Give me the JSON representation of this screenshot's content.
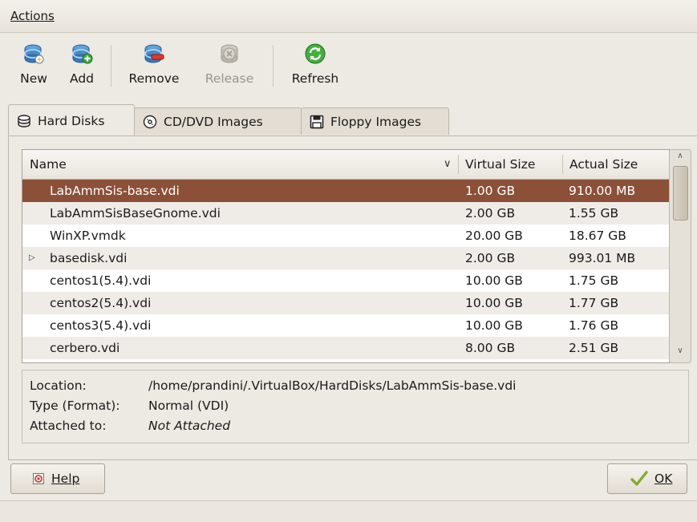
{
  "menubar": {
    "actions_label": "Actions"
  },
  "toolbar": {
    "new_label": "New",
    "add_label": "Add",
    "remove_label": "Remove",
    "release_label": "Release",
    "refresh_label": "Refresh"
  },
  "tabs": [
    {
      "label": "Hard Disks",
      "icon": "hard-disk-icon",
      "active": true
    },
    {
      "label": "CD/DVD Images",
      "icon": "cd-dvd-icon",
      "active": false
    },
    {
      "label": "Floppy Images",
      "icon": "floppy-icon",
      "active": false
    }
  ],
  "table": {
    "columns": [
      "Name",
      "Virtual Size",
      "Actual Size"
    ],
    "rows": [
      {
        "name": "LabAmmSis-base.vdi",
        "virtual_size": "1.00 GB",
        "actual_size": "910.00 MB",
        "selected": true,
        "expandable": false
      },
      {
        "name": "LabAmmSisBaseGnome.vdi",
        "virtual_size": "2.00 GB",
        "actual_size": "1.55 GB",
        "selected": false,
        "expandable": false
      },
      {
        "name": "WinXP.vmdk",
        "virtual_size": "20.00 GB",
        "actual_size": "18.67 GB",
        "selected": false,
        "expandable": false
      },
      {
        "name": "basedisk.vdi",
        "virtual_size": "2.00 GB",
        "actual_size": "993.01 MB",
        "selected": false,
        "expandable": true
      },
      {
        "name": "centos1(5.4).vdi",
        "virtual_size": "10.00 GB",
        "actual_size": "1.75 GB",
        "selected": false,
        "expandable": false
      },
      {
        "name": "centos2(5.4).vdi",
        "virtual_size": "10.00 GB",
        "actual_size": "1.77 GB",
        "selected": false,
        "expandable": false
      },
      {
        "name": "centos3(5.4).vdi",
        "virtual_size": "10.00 GB",
        "actual_size": "1.76 GB",
        "selected": false,
        "expandable": false
      },
      {
        "name": "cerbero.vdi",
        "virtual_size": "8.00 GB",
        "actual_size": "2.51 GB",
        "selected": false,
        "expandable": false
      }
    ]
  },
  "details": {
    "location_label": "Location:",
    "location_value": "/home/prandini/.VirtualBox/HardDisks/LabAmmSis-base.vdi",
    "type_label": "Type (Format):",
    "type_value": "Normal (VDI)",
    "attached_label": "Attached to:",
    "attached_value": "Not Attached"
  },
  "buttons": {
    "help_label": "Help",
    "ok_label": "OK"
  },
  "colors": {
    "selection": "#8c5039",
    "window_bg": "#ede9e3",
    "refresh_green": "#2f9a2b",
    "disk_blue": "#3f7fc0"
  }
}
